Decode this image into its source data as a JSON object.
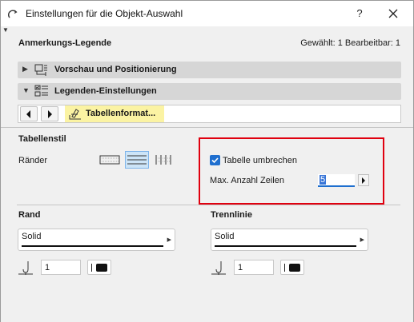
{
  "window": {
    "title": "Einstellungen für die Objekt-Auswahl",
    "help_label": "?",
    "close_label": "close"
  },
  "header": {
    "title": "Anmerkungs-Legende",
    "status": "Gewählt: 1 Bearbeitbar: 1"
  },
  "sections": [
    {
      "label": "Vorschau und Positionierung",
      "expanded": false,
      "icon": "preview-positioning-icon"
    },
    {
      "label": "Legenden-Einstellungen",
      "expanded": true,
      "icon": "legend-settings-icon"
    }
  ],
  "tabs": {
    "prev_icon": "chevron-left-icon",
    "next_icon": "chevron-right-icon",
    "active_label": "Tabellenformat...",
    "active_icon": "table-format-icon"
  },
  "table_style": {
    "heading": "Tabellenstil",
    "borders_label": "Ränder",
    "border_options": [
      "border-all-icon",
      "border-horizontal-icon",
      "border-vertical-icon"
    ],
    "selected_border": 1
  },
  "wrap": {
    "checkbox_label": "Tabelle umbrechen",
    "checked": true,
    "max_rows_label": "Max. Anzahl Zeilen",
    "max_rows_value": "5"
  },
  "rand": {
    "heading": "Rand",
    "line_type": "Solid",
    "pen_value": "1"
  },
  "trennlinie": {
    "heading": "Trennlinie",
    "line_type": "Solid",
    "pen_value": "1"
  },
  "colors": {
    "accent": "#1f6fcf",
    "highlight_tab": "#fbf3a3",
    "red_frame": "#e0000f"
  }
}
